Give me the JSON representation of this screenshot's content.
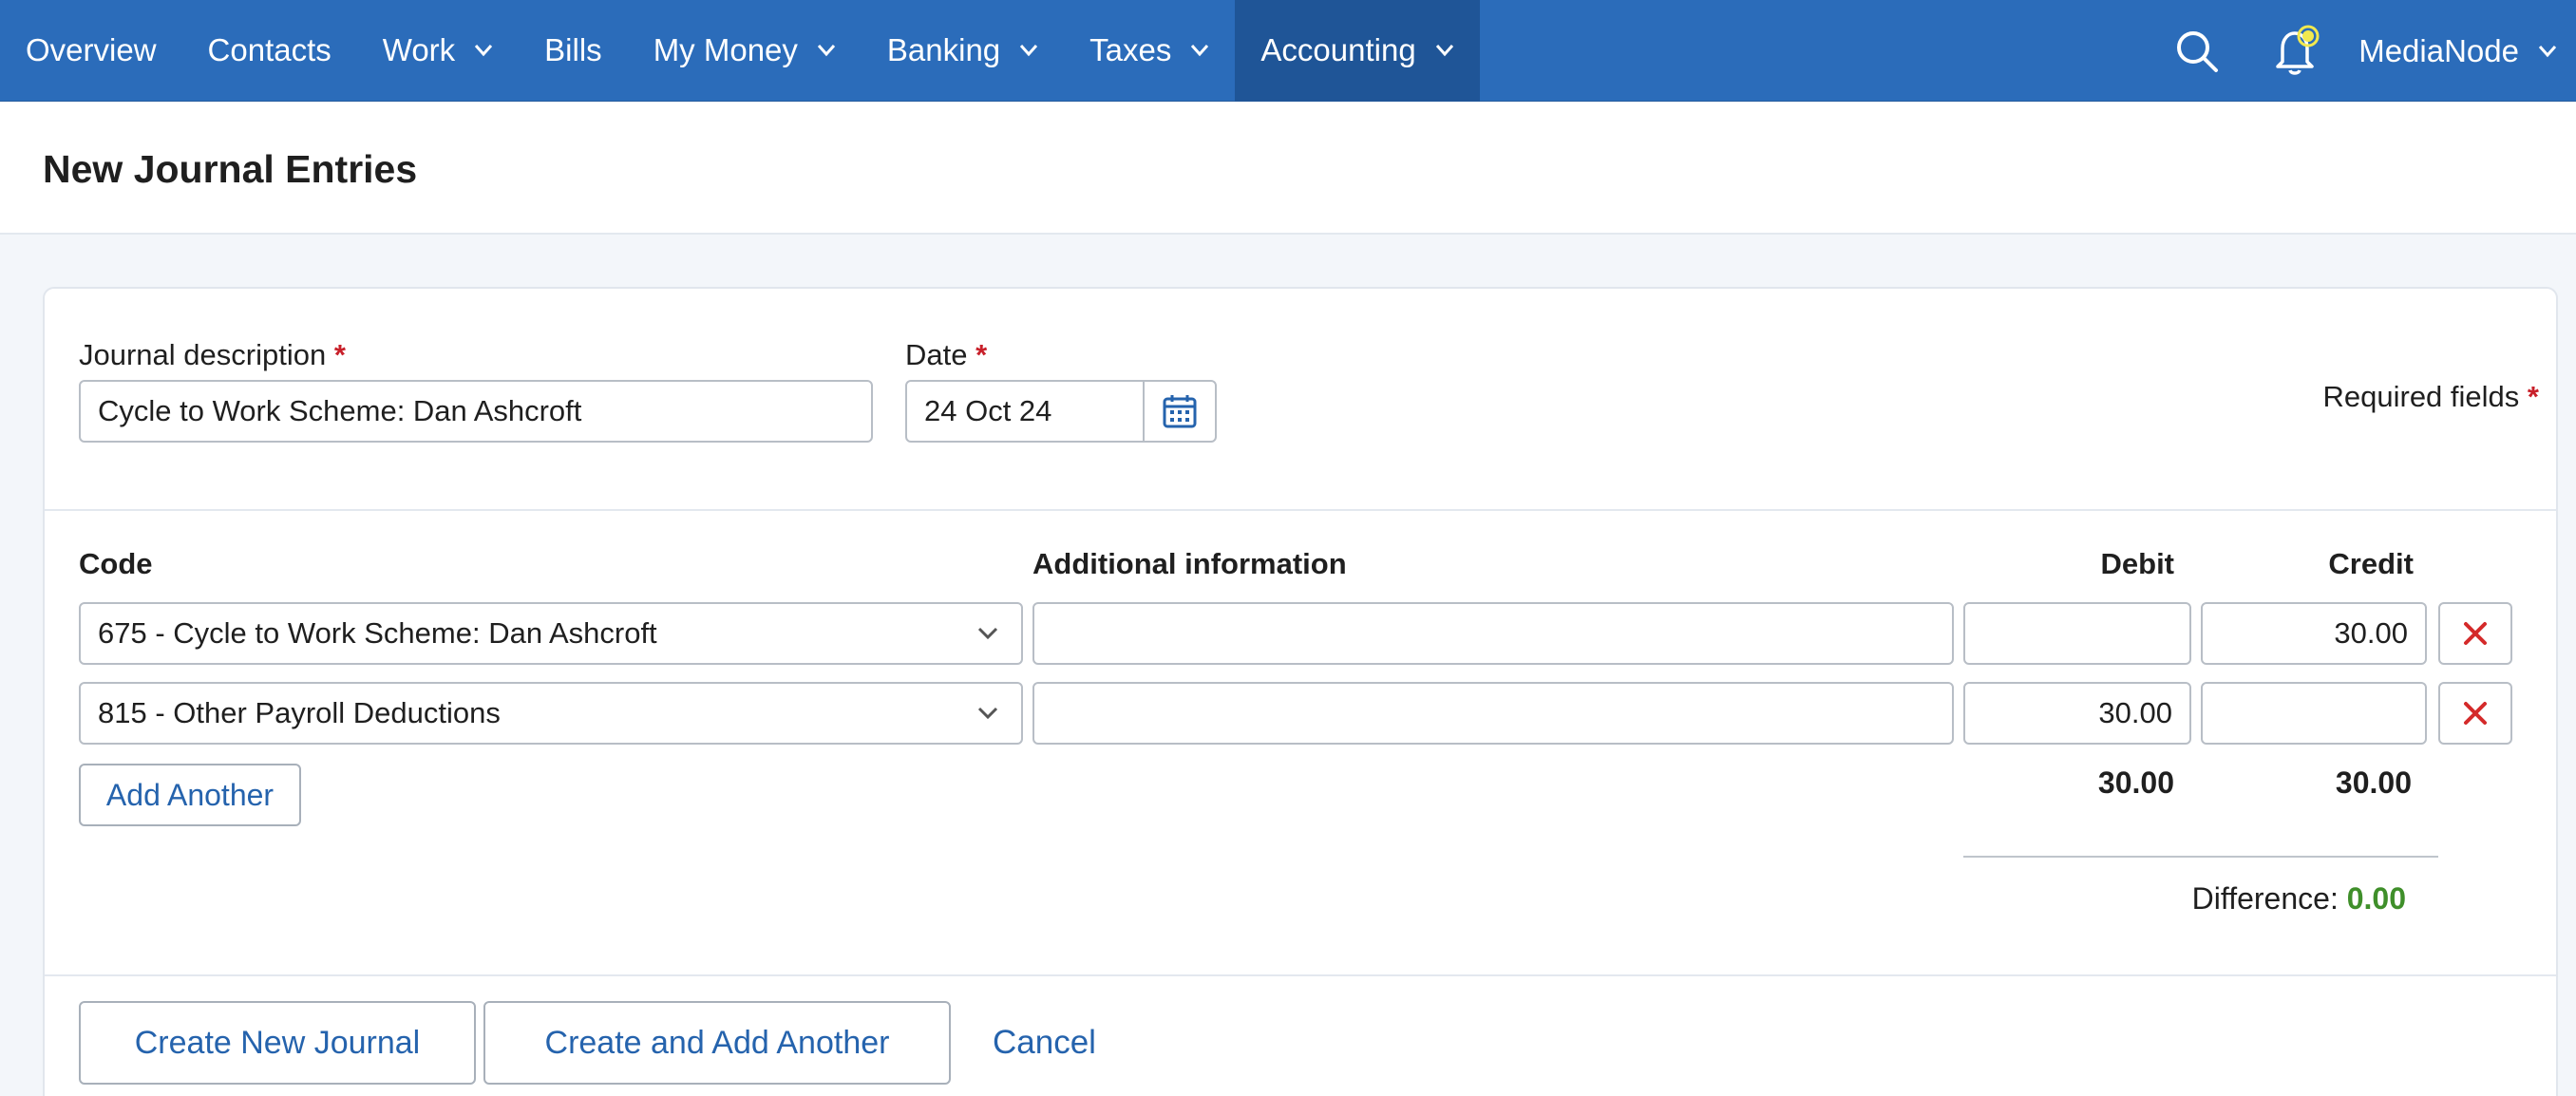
{
  "nav": {
    "items": [
      {
        "label": "Overview",
        "has_dropdown": false,
        "active": false
      },
      {
        "label": "Contacts",
        "has_dropdown": false,
        "active": false
      },
      {
        "label": "Work",
        "has_dropdown": true,
        "active": false
      },
      {
        "label": "Bills",
        "has_dropdown": false,
        "active": false
      },
      {
        "label": "My Money",
        "has_dropdown": true,
        "active": false
      },
      {
        "label": "Banking",
        "has_dropdown": true,
        "active": false
      },
      {
        "label": "Taxes",
        "has_dropdown": true,
        "active": false
      },
      {
        "label": "Accounting",
        "has_dropdown": true,
        "active": true
      }
    ],
    "search_icon": "search-icon",
    "bell_icon": "bell-icon",
    "user_name": "MediaNode",
    "colors": {
      "bar": "#2b6cba",
      "active": "#1f5597",
      "notification_dot": "#f2e94e"
    }
  },
  "page": {
    "title": "New Journal Entries"
  },
  "form": {
    "description_label": "Journal description",
    "description_value": "Cycle to Work Scheme: Dan Ashcroft",
    "date_label": "Date",
    "date_value": "24 Oct 24",
    "required_marker": "*",
    "required_fields_label": "Required fields"
  },
  "table": {
    "headers": {
      "code": "Code",
      "info": "Additional information",
      "debit": "Debit",
      "credit": "Credit"
    },
    "rows": [
      {
        "code": "675 - Cycle to Work Scheme: Dan Ashcroft",
        "info": "",
        "debit": "",
        "credit": "30.00"
      },
      {
        "code": "815 - Other Payroll Deductions",
        "info": "",
        "debit": "30.00",
        "credit": ""
      }
    ],
    "add_another_label": "Add Another",
    "total_debit": "30.00",
    "total_credit": "30.00",
    "difference_label": "Difference:",
    "difference_value": "0.00",
    "colors": {
      "difference_ok": "#3f8f2a",
      "delete": "#d42a2a"
    }
  },
  "actions": {
    "create_label": "Create New Journal",
    "create_add_label": "Create and Add Another",
    "cancel_label": "Cancel"
  }
}
